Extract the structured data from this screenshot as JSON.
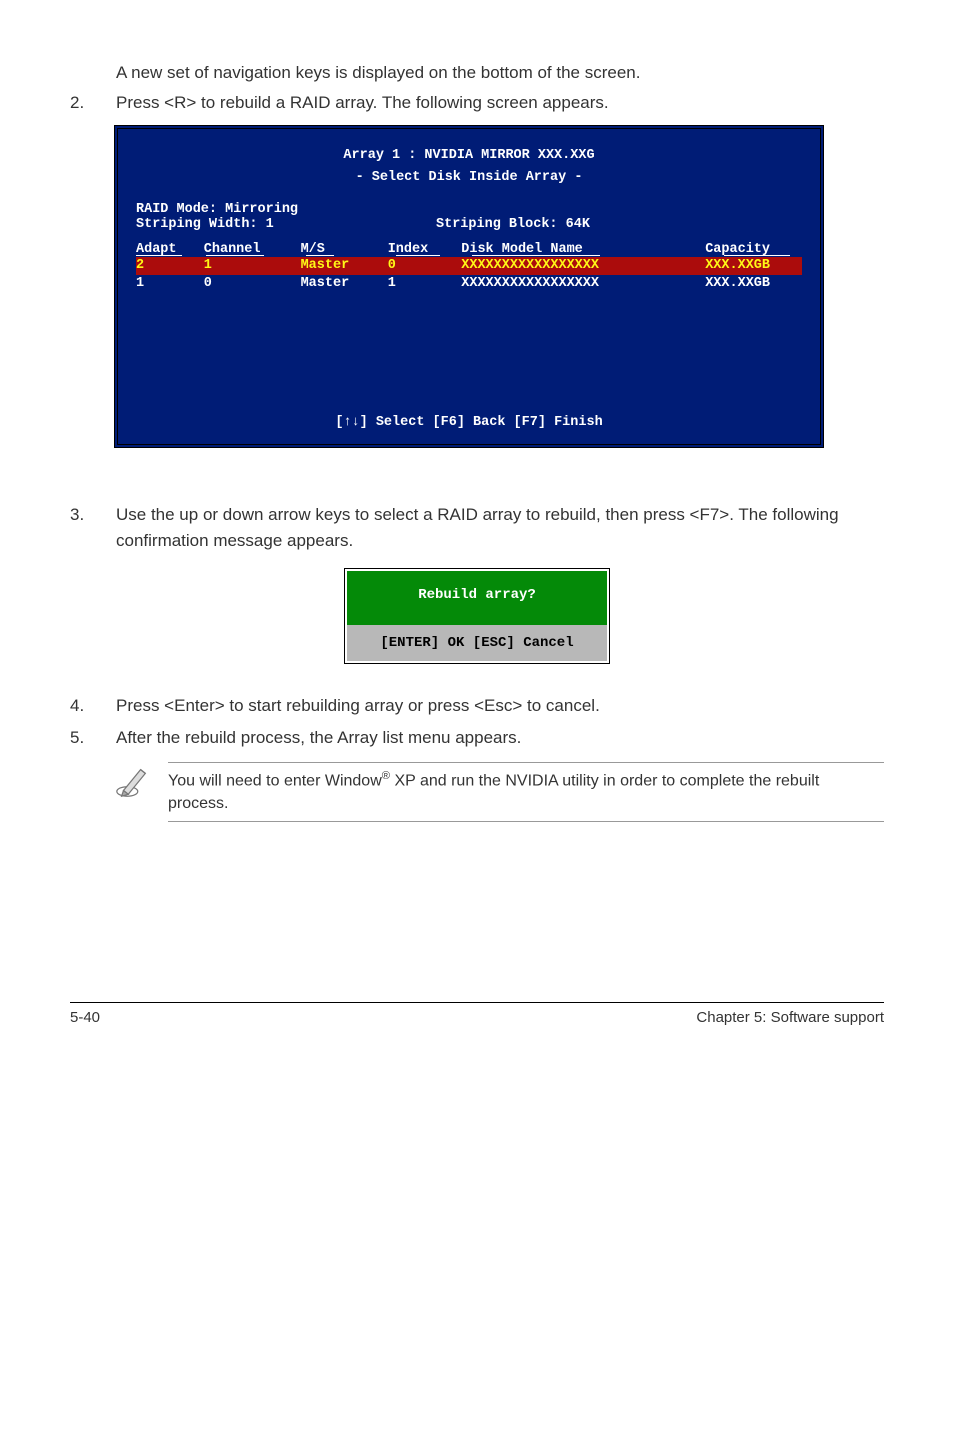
{
  "intro_text": "A new set of  navigation keys is displayed on the bottom of the screen.",
  "step2": {
    "num": "2.",
    "text": "Press <R> to rebuild a RAID array. The following screen appears."
  },
  "bios": {
    "title1": "Array 1 : NVIDIA MIRROR  XXX.XXG",
    "title2": "- Select Disk Inside Array -",
    "raid_mode": "RAID Mode: Mirroring",
    "strip_width": "Striping Width: 1",
    "strip_block": "Striping Block: 64K",
    "headers": {
      "adapt": "Adapt",
      "channel": "Channel",
      "ms": "M/S",
      "index": "Index",
      "model": "Disk Model Name",
      "cap": "Capacity"
    },
    "rows": [
      {
        "adapt": "2",
        "channel": "1",
        "ms": "Master",
        "index": "0",
        "model": "XXXXXXXXXXXXXXXXX",
        "cap": "XXX.XXGB",
        "selected": true
      },
      {
        "adapt": "1",
        "channel": "0",
        "ms": "Master",
        "index": "1",
        "model": "XXXXXXXXXXXXXXXXX",
        "cap": "XXX.XXGB",
        "selected": false
      }
    ],
    "footer": "[↑↓] Select [F6] Back  [F7] Finish"
  },
  "step3": {
    "num": "3.",
    "text": "Use the up or down arrow keys to select a RAID array to rebuild, then press <F7>. The following confirmation message appears."
  },
  "modal": {
    "question": "Rebuild array?",
    "actions": "[ENTER] OK   [ESC] Cancel"
  },
  "step4": {
    "num": "4.",
    "text": "Press <Enter> to start rebuilding array or press <Esc> to cancel."
  },
  "step5": {
    "num": "5.",
    "text": "After the rebuild process, the Array list menu appears."
  },
  "note": {
    "pre": "You will need to enter Window",
    "reg": "®",
    "post": " XP and run the NVIDIA utility in order to complete the rebuilt process."
  },
  "footer": {
    "left": "5-40",
    "right": "Chapter 5: Software support"
  }
}
